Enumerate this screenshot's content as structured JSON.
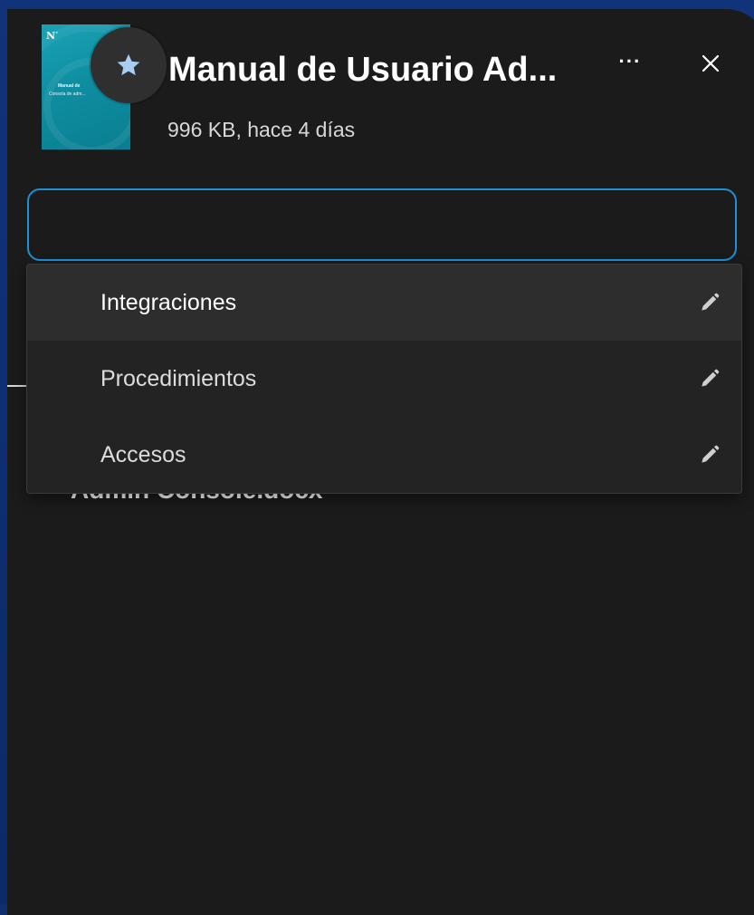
{
  "file": {
    "title": "Manual de Usuario Ad...",
    "meta": "996 KB, hace 4 días",
    "thumbnail": {
      "logo": "N",
      "line1": "Manual de",
      "line2": "Consola de adm..."
    }
  },
  "header": {
    "favorite_icon": "star-icon",
    "more_label": "···",
    "close_icon": "close-icon"
  },
  "tag_input": {
    "value": "",
    "placeholder": ""
  },
  "dropdown": {
    "options": [
      {
        "label": "Integraciones",
        "active": true
      },
      {
        "label": "Procedimientos",
        "active": false
      },
      {
        "label": "Accesos",
        "active": false
      }
    ],
    "edit_icon": "pencil-icon"
  },
  "background": {
    "filename_fragment": "Admin Console.docx"
  },
  "colors": {
    "panel": "#1b1b1b",
    "accent": "#1f8fd6",
    "backdrop": "#0b2a66",
    "thumbnail": "#1aa3b5"
  }
}
